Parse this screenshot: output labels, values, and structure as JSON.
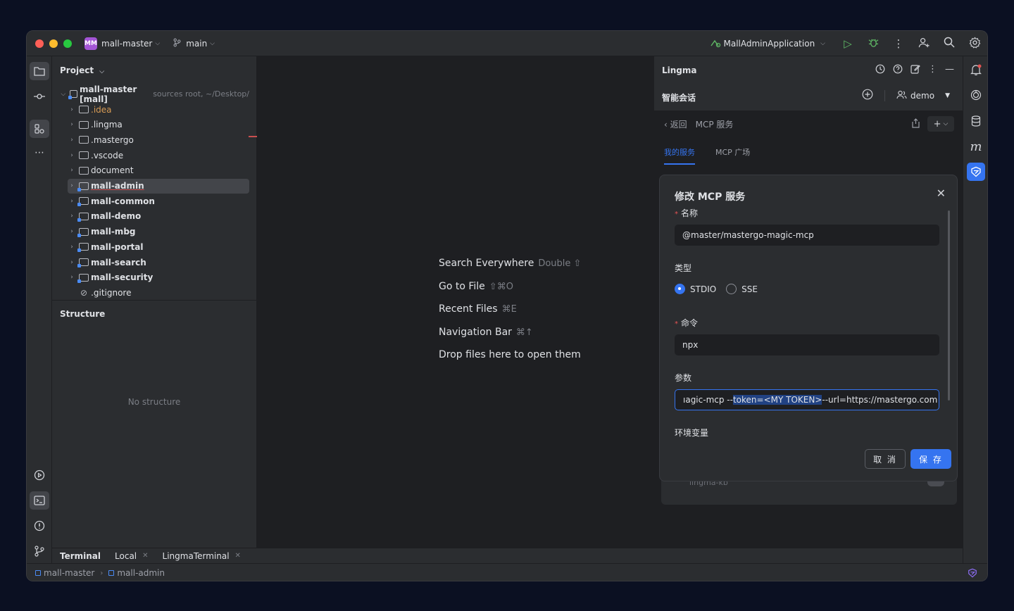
{
  "titlebar": {
    "project_badge": "MM",
    "project_name": "mall-master",
    "branch": "main",
    "run_config": "MallAdminApplication"
  },
  "project_panel": {
    "title": "Project",
    "root": {
      "name": "mall-master [mall]",
      "meta": "sources root, ~/Desktop/"
    },
    "items": [
      {
        "name": ".idea",
        "style": "orange"
      },
      {
        "name": ".lingma",
        "style": "normal"
      },
      {
        "name": ".mastergo",
        "style": "normal"
      },
      {
        "name": ".vscode",
        "style": "normal"
      },
      {
        "name": "document",
        "style": "normal"
      },
      {
        "name": "mall-admin",
        "style": "bold"
      },
      {
        "name": "mall-common",
        "style": "bold"
      },
      {
        "name": "mall-demo",
        "style": "bold"
      },
      {
        "name": "mall-mbg",
        "style": "bold"
      },
      {
        "name": "mall-portal",
        "style": "bold"
      },
      {
        "name": "mall-search",
        "style": "bold"
      },
      {
        "name": "mall-security",
        "style": "bold"
      },
      {
        "name": ".gitignore",
        "style": "normal"
      }
    ],
    "structure_title": "Structure",
    "no_structure": "No structure"
  },
  "editor_hints": [
    {
      "label": "Search Everywhere",
      "key": "Double ⇧"
    },
    {
      "label": "Go to File",
      "key": "⇧⌘O"
    },
    {
      "label": "Recent Files",
      "key": "⌘E"
    },
    {
      "label": "Navigation Bar",
      "key": "⌘↑"
    },
    {
      "label": "Drop files here to open them",
      "key": ""
    }
  ],
  "lingma": {
    "title": "Lingma",
    "subtitle": "智能会话",
    "user": "demo",
    "back_label": "返回",
    "section_title": "MCP 服务",
    "tabs": [
      "我的服务",
      "MCP 广场"
    ],
    "bg_item": "lingma-kb",
    "dialog": {
      "title": "修改 MCP 服务",
      "name_label": "名称",
      "name_value": "@master/mastergo-magic-mcp",
      "type_label": "类型",
      "type_options": [
        "STDIO",
        "SSE"
      ],
      "command_label": "命令",
      "command_value": "npx",
      "args_label": "参数",
      "args_before": "ıagic-mcp --",
      "args_selected": "token=<MY TOKEN>",
      "args_after": " --url=https://mastergo.com",
      "env_label": "环境变量",
      "cancel": "取 消",
      "save": "保 存"
    }
  },
  "bottom_tabs": [
    "Terminal",
    "Local",
    "LingmaTerminal"
  ],
  "statusbar": {
    "crumb1": "mall-master",
    "crumb2": "mall-admin"
  }
}
